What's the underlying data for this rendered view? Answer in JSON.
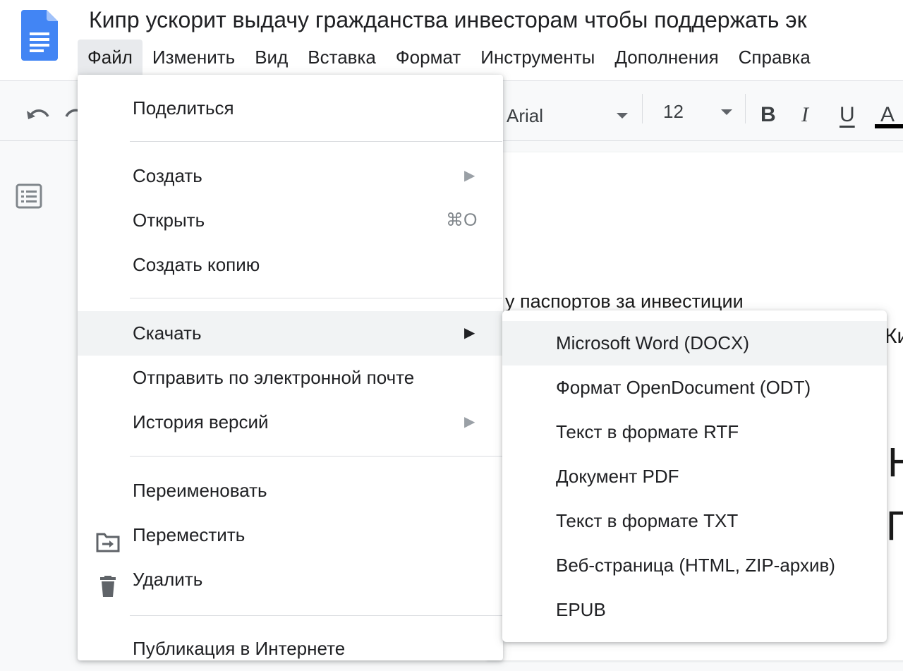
{
  "document": {
    "title": "Кипр ускорит выдачу гражданства инвесторам чтобы поддержать эк",
    "body_lines": [
      "у паспортов за инвестиции",
      "Ки",
      "Н",
      "П"
    ]
  },
  "menubar": {
    "items": [
      "Файл",
      "Изменить",
      "Вид",
      "Вставка",
      "Формат",
      "Инструменты",
      "Дополнения",
      "Справка"
    ],
    "active": "Файл"
  },
  "toolbar": {
    "font_name": "Arial",
    "font_size": "12",
    "bold": "B",
    "italic": "I",
    "underline": "U",
    "text_color": "A",
    "text_color_value": "#000000"
  },
  "file_menu": {
    "share": "Поделиться",
    "create": "Создать",
    "open": "Открыть",
    "open_shortcut": "⌘O",
    "make_copy": "Создать копию",
    "download": "Скачать",
    "email": "Отправить по электронной почте",
    "version_history": "История версий",
    "rename": "Переименовать",
    "move": "Переместить",
    "delete": "Удалить",
    "publish": "Публикация в Интернете"
  },
  "download_submenu": {
    "items": [
      "Microsoft Word (DOCX)",
      "Формат OpenDocument (ODT)",
      "Текст в формате RTF",
      "Документ PDF",
      "Текст в формате TXT",
      "Веб-страница (HTML, ZIP-архив)",
      "EPUB"
    ],
    "highlighted": "Microsoft Word (DOCX)"
  },
  "icons": {
    "docs_logo": "google-docs-icon",
    "undo": "undo-icon",
    "redo": "redo-icon",
    "outline": "document-outline-icon",
    "submenu_arrow": "submenu-arrow-icon",
    "move": "folder-move-icon",
    "delete": "trash-icon"
  },
  "colors": {
    "docs_blue": "#4285f4",
    "menu_hover": "#f1f3f4",
    "active_menu": "#e8eaed"
  }
}
